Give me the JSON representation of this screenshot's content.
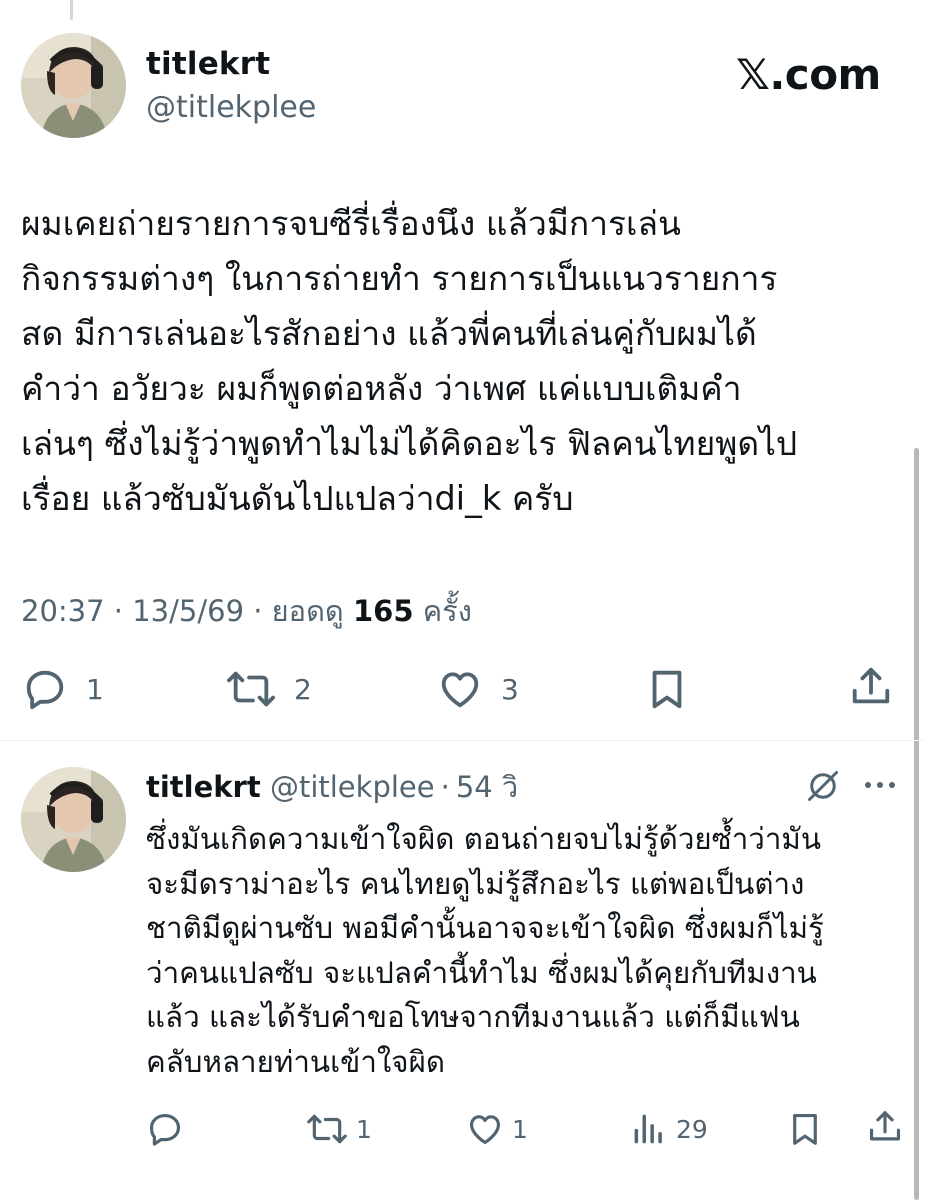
{
  "main_tweet": {
    "display_name": "titlekrt",
    "handle": "@titlekplee",
    "brand": "𝕏.com",
    "lines": [
      "ผมเคยถ่ายรายการจบซีรี่เรื่องนึง แล้วมีการเล่น",
      "กิจกรรมต่างๆ ในการถ่ายทำ รายการเป็นแนวรายการ",
      "สด มีการเล่นอะไรสักอย่าง แล้วพี่คนที่เล่นคู่กับผมได้",
      "คำว่า อวัยวะ ผมก็พูดต่อหลัง ว่าเพศ แค่แบบเติมคำ",
      "เล่นๆ ซึ่งไม่รู้ว่าพูดทำไมไม่ได้คิดอะไร ฟิลคนไทยพูดไป",
      "เรื่อย แล้วซับมันดันไปแปลว่าdi_k ครับ"
    ],
    "timestamp": "20:37 · 13/5/69 · ยอดดู ",
    "views": "165",
    "views_suffix": " ครั้ง",
    "actions": {
      "replies": "1",
      "reposts": "2",
      "likes": "3"
    }
  },
  "reply_tweet": {
    "display_name": "titlekrt",
    "handle": "@titlekplee",
    "separator": "·",
    "time": "54 วิ",
    "lines": [
      "ซึ่งมันเกิดความเข้าใจผิด ตอนถ่ายจบไม่รู้ด้วยซ้ำว่ามัน",
      "จะมีดราม่าอะไร คนไทยดูไม่รู้สึกอะไร แต่พอเป็นต่าง",
      "ชาติมีดูผ่านซับ พอมีคำนั้นอาจจะเข้าใจผิด ซึ่งผมก็ไม่รู้",
      "ว่าคนแปลซับ จะแปลคำนี้ทำไม ซึ่งผมได้คุยกับทีมงาน",
      "แล้ว และได้รับคำขอโทษจากทีมงานแล้ว แต่ก็มีแฟน",
      "คลับหลายท่านเข้าใจผิด"
    ],
    "actions": {
      "replies": "",
      "reposts": "1",
      "likes": "1",
      "views": "29"
    }
  },
  "colors": {
    "text": "#0f1419",
    "secondary": "#536471",
    "divider": "#eff3f4"
  },
  "icons": [
    "reply-icon",
    "repost-icon",
    "like-icon",
    "bookmark-icon",
    "share-icon",
    "views-icon",
    "grok-icon",
    "more-icon"
  ]
}
